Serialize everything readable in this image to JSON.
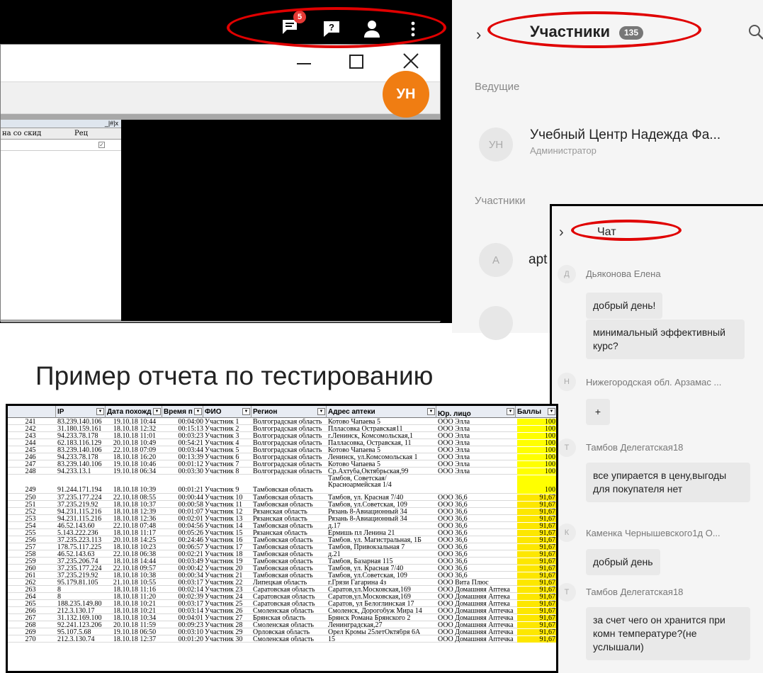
{
  "toolbar": {
    "chat_badge": "5",
    "icons": [
      "chat-icon",
      "help-icon",
      "user-icon",
      "more-icon"
    ]
  },
  "shared_window": {
    "grid_headers": [
      "на со скид",
      "Рец"
    ],
    "grid_title_controls": "_|#|x",
    "avatar_initials": "УН"
  },
  "participants": {
    "title": "Участники",
    "count": "135",
    "section_hosts": "Ведущие",
    "host": {
      "initials": "УН",
      "name": "Учебный Центр Надежда Фа...",
      "role": "Администратор"
    },
    "section_participants": "Участники",
    "participant": {
      "initials": "А",
      "name": "apt"
    }
  },
  "chat": {
    "title": "Чат",
    "messages": [
      {
        "initials": "Д",
        "name": "Дьяконова Елена",
        "bubbles": [
          "добрый день!",
          "минимальный эффективный курс?"
        ]
      },
      {
        "initials": "Н",
        "name": "Нижегородская обл. Арзамас ...",
        "bubbles": [
          "+"
        ]
      },
      {
        "initials": "Т",
        "name": "Тамбов Делегатская18",
        "bubbles": [
          "все упирается в цену,выгоды для покупателя нет"
        ]
      },
      {
        "initials": "К",
        "name": "Каменка Чернышевского1д О...",
        "bubbles": [
          "добрый день"
        ]
      },
      {
        "initials": "Т",
        "name": "Тамбов Делегатская18",
        "bubbles": [
          "за счет чего он хранится при комн температуре?(не услышали)"
        ]
      }
    ]
  },
  "caption": "Пример отчета по тестированию",
  "report": {
    "headers": [
      "IP",
      "Дата похожд",
      "Время п",
      "ФИО",
      "Регион",
      "Адрес аптеки",
      "Юр. лицо",
      "Баллы"
    ],
    "rows": [
      [
        "241",
        "83.239.140.106",
        "19.10.18 10:44",
        "00:04:00",
        "Участник 1",
        "Волгоградская область",
        "Котово Чапаева 5",
        "ООО Элла",
        "100"
      ],
      [
        "242",
        "31.180.159.161",
        "18.10.18 12:32",
        "00:15:13",
        "Участник 2",
        "Волгоградская область",
        "Плласовка Остравская11",
        "ООО Элла",
        "100"
      ],
      [
        "243",
        "94.233.78.178",
        "18.10.18 11:01",
        "00:03:23",
        "Участник 3",
        "Волгоградская область",
        "г.Ленинск, Комсомольская,1",
        "ООО Элла",
        "100"
      ],
      [
        "244",
        "62.183.116.129",
        "20.10.18 10:49",
        "00:54:21",
        "Участник 4",
        "Волгоградская область",
        "Палласовка, Остравская, 11",
        "ООО Элла",
        "100"
      ],
      [
        "245",
        "83.239.140.106",
        "22.10.18 07:09",
        "00:03:44",
        "Участник 5",
        "Волгоградская область",
        "Котово Чапаева 5",
        "ООО Элла",
        "100"
      ],
      [
        "246",
        "94.233.78.178",
        "18.10.18 16:20",
        "00:13:39",
        "Участник 6",
        "Волгоградская область",
        "Ленинск, ул.Комсомольская 1",
        "ООО Элла",
        "100"
      ],
      [
        "247",
        "83.239.140.106",
        "19.10.18 10:46",
        "00:01:12",
        "Участник 7",
        "Волгоградская область",
        "Котово Чапаева 5",
        "ООО Элла",
        "100"
      ],
      [
        "248",
        "94.233.13.1",
        "19.10.18 06:34",
        "00:03:30",
        "Участник 8",
        "Волгоградская область",
        "Ср.Ахтуба,Октябрьская,99",
        "ООО Элла",
        "100"
      ],
      [
        "249",
        "91.244.171.194",
        "18.10.18 10:39",
        "00:01:21",
        "Участник 9",
        "Тамбовская область",
        "Тамбов, Советская/Красноармейская 1/4",
        "",
        "100"
      ],
      [
        "250",
        "37.235.177.224",
        "22.10.18 08:55",
        "00:00:44",
        "Участник 10",
        "Тамбовская область",
        "Тамбов, ул. Красная 7/40",
        "ООО 36,6",
        "91,67"
      ],
      [
        "251",
        "37.235.219.92",
        "18.10.18 10:37",
        "00:00:58",
        "Участник 11",
        "Тамбовская область",
        "Тамбов, ул.Советская, 109",
        "ООО 36,6",
        "91,67"
      ],
      [
        "252",
        "94.231.115.216",
        "18.10.18 12:39",
        "00:01:07",
        "Участник 12",
        "Рязанская область",
        "Рязань 8-Авиационный 34",
        "ООО 36,6",
        "91,67"
      ],
      [
        "253",
        "94.231.115.216",
        "18.10.18 12:36",
        "00:02:01",
        "Участник 13",
        "Рязанская область",
        "Рязань 8-Авиационный 34",
        "ООО 36,6",
        "91,67"
      ],
      [
        "254",
        "46.52.143.60",
        "22.10.18 07:48",
        "00:04:56",
        "Участник 14",
        "Тамбовская область",
        "д.17",
        "ООО 36,6",
        "91,67"
      ],
      [
        "255",
        "5.143.222.236",
        "18.10.18 11:17",
        "00:05:26",
        "Участник 15",
        "Рязанская область",
        "Ермишь пл Ленина 21",
        "ООО 36,6",
        "91,67"
      ],
      [
        "256",
        "37.235.223.113",
        "20.10.18 14:25",
        "00:24:46",
        "Участник 16",
        "Тамбовская область",
        "Тамбов. ул. Магистральная, 1Б",
        "ООО 36,6",
        "91,67"
      ],
      [
        "257",
        "178.75.117.225",
        "18.10.18 10:23",
        "00:06:57",
        "Участник 17",
        "Тамбовская область",
        "Тамбов, Привокзальная 7",
        "ООО 36,6",
        "91,67"
      ],
      [
        "258",
        "46.52.143.63",
        "22.10.18 06:38",
        "00:02:21",
        "Участник 18",
        "Тамбовская область",
        "д.21",
        "ООО 36,6",
        "91,67"
      ],
      [
        "259",
        "37.235.206.74",
        "18.10.18 14:44",
        "00:03:49",
        "Участник 19",
        "Тамбовская область",
        "Тамбов, Базарная 115",
        "ООО 36,6",
        "91,67"
      ],
      [
        "260",
        "37.235.177.224",
        "22.10.18 09:57",
        "00:00:42",
        "Участник 20",
        "Тамбовская область",
        "Тамбов, ул. Красная 7/40",
        "ООО 36,6",
        "91,67"
      ],
      [
        "261",
        "37.235.219.92",
        "18.10.18 10:38",
        "00:00:34",
        "Участник 21",
        "Тамбовская область",
        "Тамбов, ул.Советская, 109",
        "ООО 36,6",
        "91,67"
      ],
      [
        "262",
        "95.179.81.105",
        "21.10.18 10:55",
        "00:03:17",
        "Участник 22",
        "Липецкая область",
        "г.Грязи Гагарина 4з",
        "ООО Вита Плюс",
        "91,67"
      ],
      [
        "263",
        "8",
        "18.10.18 11:16",
        "00:02:14",
        "Участник 23",
        "Саратовская область",
        "Саратов,ул.Московская,169",
        "ООО Домашняя Аптека",
        "91,67"
      ],
      [
        "264",
        "8",
        "18.10.18 11:20",
        "00:02:39",
        "Участник 24",
        "Саратовская область",
        "Саратов,ул.Московская,169",
        "ООО Домашняя Аптека",
        "91,67"
      ],
      [
        "265",
        "188.235.149.80",
        "18.10.18 10:21",
        "00:03:17",
        "Участник 25",
        "Саратовская область",
        "Саратов, ул Белоглинская 17",
        "ООО Домашняя Аптека",
        "91,67"
      ],
      [
        "266",
        "212.3.130.17",
        "18.10.18 10:21",
        "00:03:14",
        "Участник 26",
        "Смоленская область",
        "Смоленск, Дорогобуж Мира 14",
        "ООО Домашняя Аптечка",
        "91,67"
      ],
      [
        "267",
        "31.132.169.100",
        "18.10.18 10:34",
        "00:04:01",
        "Участник 27",
        "Брянская область",
        "Брянск Романа Брянского 2",
        "ООО Домашняя Аптечка",
        "91,67"
      ],
      [
        "268",
        "92.241.123.206",
        "20.10.18 11:59",
        "00:09:23",
        "Участник 28",
        "Смоленская область",
        "Ленинградская,27",
        "ООО Домашняя Аптечка",
        "91,67"
      ],
      [
        "269",
        "95.107.5.68",
        "19.10.18 06:50",
        "00:03:10",
        "Участник 29",
        "Орловская область",
        "Орел Кромы 25летОктября 6А",
        "ООО Домашняя Аптечка",
        "91,67"
      ],
      [
        "270",
        "212.3.130.74",
        "18.10.18 12:37",
        "00:01:20",
        "Участник 30",
        "Смоленская область",
        "15",
        "ООО Домашняя Аптечка",
        "91,67"
      ]
    ]
  }
}
